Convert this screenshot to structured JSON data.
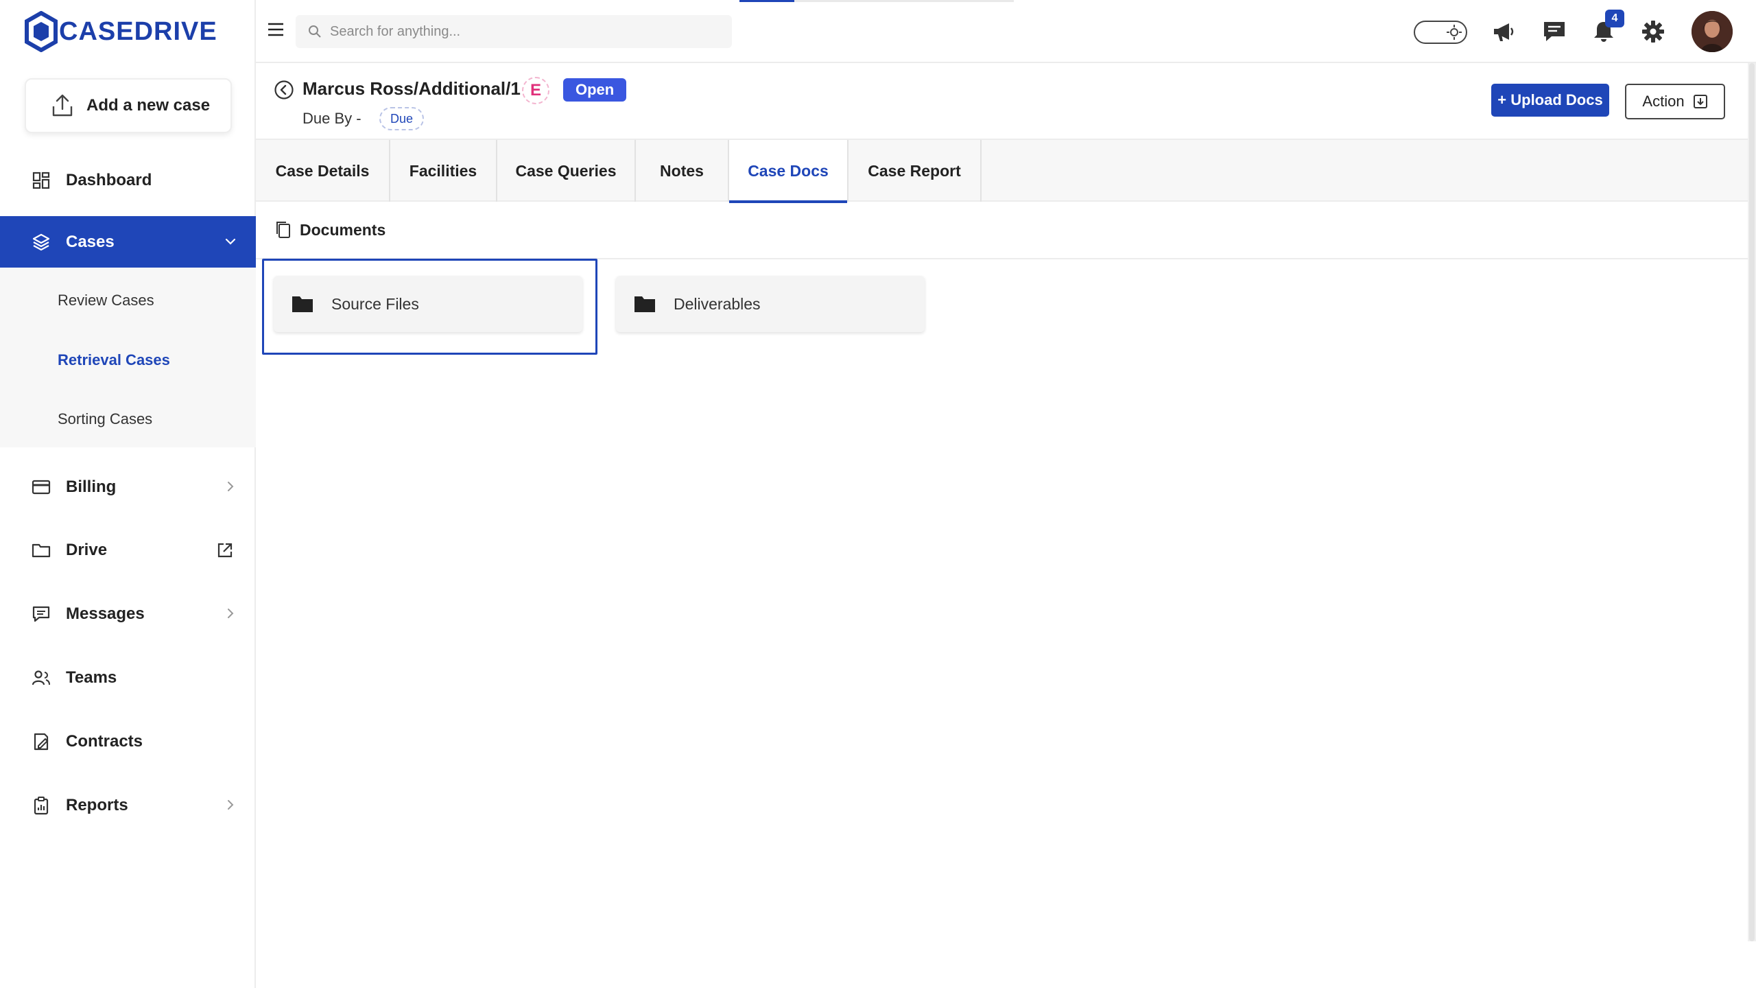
{
  "app": {
    "brand": "CASEDRIVE",
    "brand_color": "#1f46b8"
  },
  "sidebar": {
    "add_case_label": "Add a new case",
    "items": [
      {
        "label": "Dashboard",
        "icon": "dashboard-icon"
      },
      {
        "label": "Cases",
        "icon": "layers-icon",
        "active": true,
        "expanded": true
      },
      {
        "label": "Billing",
        "icon": "card-icon",
        "has_submenu": true
      },
      {
        "label": "Drive",
        "icon": "folder-icon",
        "external": true
      },
      {
        "label": "Messages",
        "icon": "message-icon",
        "has_submenu": true
      },
      {
        "label": "Teams",
        "icon": "team-icon"
      },
      {
        "label": "Contracts",
        "icon": "contract-icon"
      },
      {
        "label": "Reports",
        "icon": "clipboard-icon",
        "has_submenu": true
      }
    ],
    "cases_submenu": [
      {
        "label": "Review Cases"
      },
      {
        "label": "Retrieval Cases",
        "active": true
      },
      {
        "label": "Sorting Cases"
      }
    ]
  },
  "topbar": {
    "search_placeholder": "Search for anything...",
    "notification_count": "4",
    "icons": [
      "theme-toggle-icon",
      "megaphone-icon",
      "chat-icon",
      "bell-icon",
      "gear-icon",
      "avatar"
    ]
  },
  "case": {
    "title": "Marcus Ross/Additional/1",
    "letter_badge": "E",
    "status": "Open",
    "due_label": "Due By -",
    "due_value": "Due",
    "upload_label": "+ Upload Docs",
    "action_label": "Action"
  },
  "tabs": [
    {
      "label": "Case Details"
    },
    {
      "label": "Facilities"
    },
    {
      "label": "Case Queries"
    },
    {
      "label": "Notes"
    },
    {
      "label": "Case Docs",
      "active": true
    },
    {
      "label": "Case Report"
    }
  ],
  "documents": {
    "header": "Documents",
    "folders": [
      {
        "label": "Source Files",
        "selected": true
      },
      {
        "label": "Deliverables"
      }
    ]
  }
}
